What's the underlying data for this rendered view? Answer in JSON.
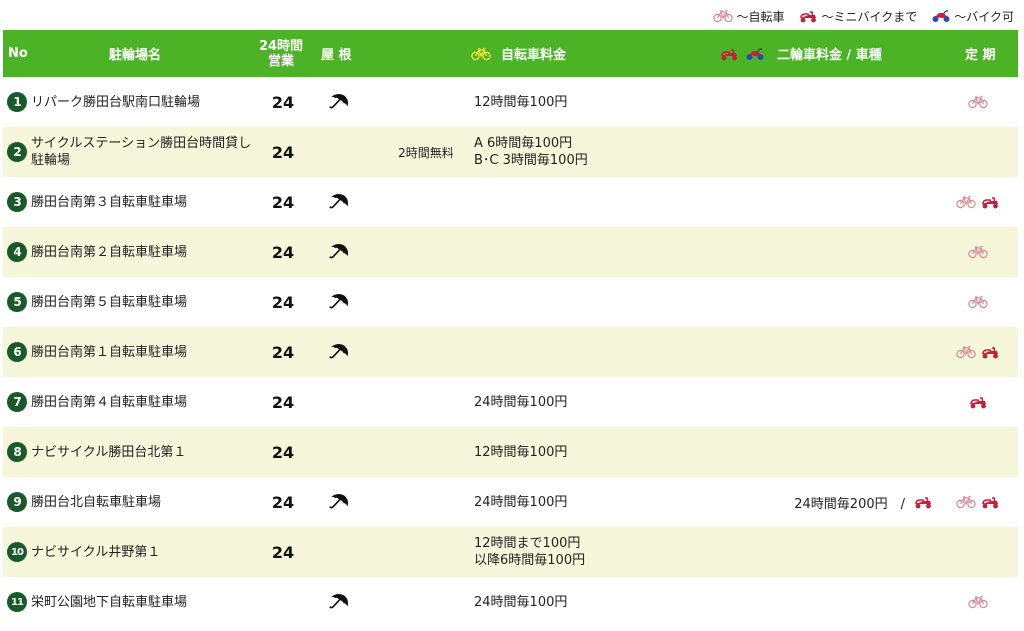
{
  "legend": {
    "bicycle": "〜自転車",
    "minibike": "〜ミニバイクまで",
    "bike": "〜バイク可"
  },
  "header": {
    "no": "No",
    "name": "駐輪場名",
    "hours_line1": "24時間",
    "hours_line2": "営業",
    "roof": "屋 根",
    "bicycle_fee": "自転車料金",
    "moto_fee": "二輪車料金 / 車種",
    "season": "定 期"
  },
  "rows": [
    {
      "num": "1",
      "name": "リパーク勝田台駅南口駐輪場",
      "hours": "24",
      "roof": true,
      "free": "",
      "fee1": "12時間毎100円",
      "fee2": "",
      "moto_fee": "",
      "season": [
        "bicycle"
      ]
    },
    {
      "num": "2",
      "name": "サイクルステーション勝田台時間貸し駐輪場",
      "hours": "24",
      "roof": false,
      "free": "2時間無料",
      "fee1": "A 6時間毎100円",
      "fee2": "B･C 3時間毎100円",
      "moto_fee": "",
      "season": []
    },
    {
      "num": "3",
      "name": "勝田台南第３自転車駐車場",
      "hours": "24",
      "roof": true,
      "free": "",
      "fee1": "",
      "fee2": "",
      "moto_fee": "",
      "season": [
        "bicycle",
        "minibike"
      ]
    },
    {
      "num": "4",
      "name": "勝田台南第２自転車駐車場",
      "hours": "24",
      "roof": true,
      "free": "",
      "fee1": "",
      "fee2": "",
      "moto_fee": "",
      "season": [
        "bicycle"
      ]
    },
    {
      "num": "5",
      "name": "勝田台南第５自転車駐車場",
      "hours": "24",
      "roof": true,
      "free": "",
      "fee1": "",
      "fee2": "",
      "moto_fee": "",
      "season": [
        "bicycle"
      ]
    },
    {
      "num": "6",
      "name": "勝田台南第１自転車駐車場",
      "hours": "24",
      "roof": true,
      "free": "",
      "fee1": "",
      "fee2": "",
      "moto_fee": "",
      "season": [
        "bicycle",
        "minibike"
      ]
    },
    {
      "num": "7",
      "name": "勝田台南第４自転車駐車場",
      "hours": "24",
      "roof": false,
      "free": "",
      "fee1": "24時間毎100円",
      "fee2": "",
      "moto_fee": "",
      "season": [
        "minibike"
      ]
    },
    {
      "num": "8",
      "name": "ナビサイクル勝田台北第１",
      "hours": "24",
      "roof": false,
      "free": "",
      "fee1": "12時間毎100円",
      "fee2": "",
      "moto_fee": "",
      "season": []
    },
    {
      "num": "9",
      "name": "勝田台北自転車駐車場",
      "hours": "24",
      "roof": true,
      "free": "",
      "fee1": "24時間毎100円",
      "fee2": "",
      "moto_fee": "24時間毎200円　/",
      "moto_icon": "minibike",
      "season": [
        "bicycle",
        "minibike"
      ]
    },
    {
      "num": "10",
      "name": "ナビサイクル井野第１",
      "hours": "24",
      "roof": false,
      "free": "",
      "fee1": "12時間まで100円",
      "fee2": "以降6時間毎100円",
      "moto_fee": "",
      "season": []
    },
    {
      "num": "11",
      "name": "栄町公園地下自転車駐車場",
      "hours": "",
      "roof": true,
      "free": "",
      "fee1": "24時間毎100円",
      "fee2": "",
      "moto_fee": "",
      "season": [
        "bicycle"
      ]
    }
  ],
  "colors": {
    "header_bg": "#4db326",
    "alt_row_bg": "#f6f7da",
    "badge_bg": "#1a5a2a",
    "bicycle_icon": "#d98a96",
    "minibike_icon": "#d01a3a",
    "bike_icon": "#1a50c0"
  },
  "icons": {
    "bicycle": "bicycle-icon",
    "minibike": "scooter-icon",
    "bike": "motorcycle-icon",
    "roof": "umbrella-icon"
  }
}
